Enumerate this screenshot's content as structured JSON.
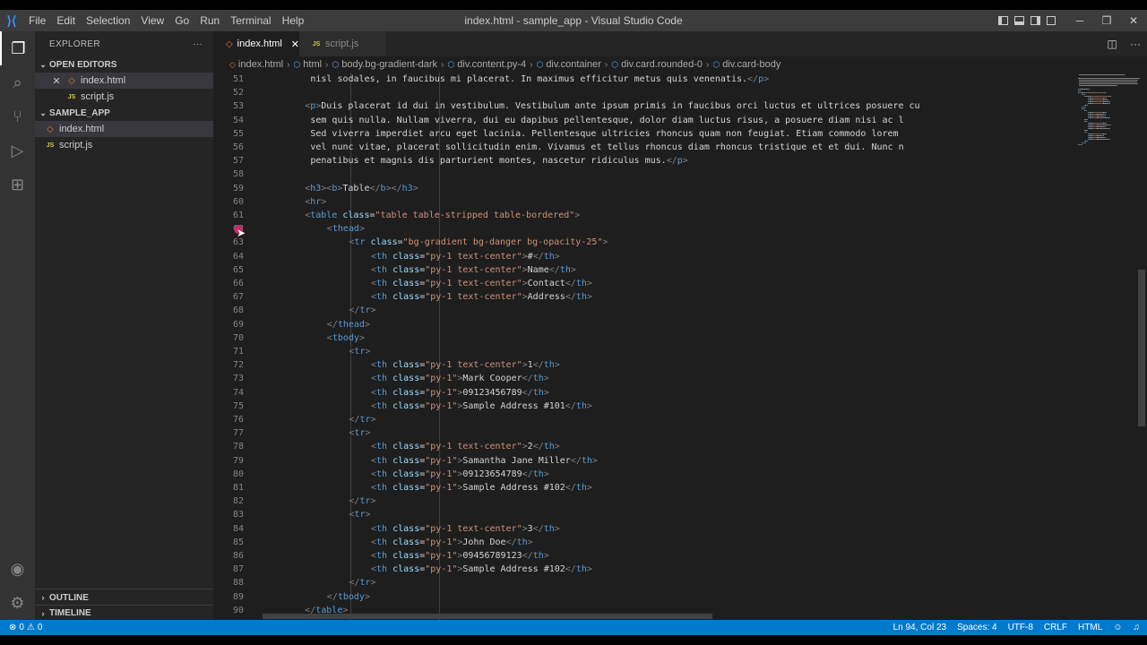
{
  "window": {
    "title": "index.html - sample_app - Visual Studio Code",
    "menu": [
      "File",
      "Edit",
      "Selection",
      "View",
      "Go",
      "Run",
      "Terminal",
      "Help"
    ],
    "minimize": "─",
    "restore": "❐",
    "close": "✕"
  },
  "activity_bar": {
    "items": [
      {
        "name": "explorer-icon",
        "glyph": "❐"
      },
      {
        "name": "search-icon",
        "glyph": "⌕"
      },
      {
        "name": "source-control-icon",
        "glyph": "⑂"
      },
      {
        "name": "run-debug-icon",
        "glyph": "▷"
      },
      {
        "name": "extensions-icon",
        "glyph": "⊞"
      }
    ],
    "accounts_glyph": "◉",
    "manage_glyph": "⚙"
  },
  "sidebar": {
    "title": "EXPLORER",
    "more": "···",
    "open_editors": {
      "label": "OPEN EDITORS",
      "files": [
        {
          "name": "index.html",
          "type": "html",
          "close": "✕"
        },
        {
          "name": "script.js",
          "type": "js"
        }
      ]
    },
    "folder": {
      "label": "SAMPLE_APP",
      "files": [
        {
          "name": "index.html",
          "type": "html"
        },
        {
          "name": "script.js",
          "type": "js"
        }
      ]
    },
    "outline": "OUTLINE",
    "timeline": "TIMELINE"
  },
  "tabs": [
    {
      "label": "index.html",
      "close": "✕",
      "active": true
    },
    {
      "label": "script.js",
      "active": false
    }
  ],
  "tab_actions": {
    "split": "◫",
    "more": "···"
  },
  "icons": {
    "html": "◇",
    "js": "JS",
    "element": "⬡",
    "chevron_right": "›",
    "chevron_down": "⌄"
  },
  "breadcrumbs": [
    {
      "label": "index.html",
      "kind": "file"
    },
    {
      "label": "html",
      "kind": "element"
    },
    {
      "label": "body.bg-gradient-dark",
      "kind": "element"
    },
    {
      "label": "div.content.py-4",
      "kind": "element"
    },
    {
      "label": "div.container",
      "kind": "element"
    },
    {
      "label": "div.card.rounded-0",
      "kind": "element"
    },
    {
      "label": "div.card-body",
      "kind": "element"
    }
  ],
  "code": [
    {
      "n": "51",
      "indent": 9,
      "t": [
        [
          "txt",
          "nisl sodales, in faucibus mi placerat. In maximus efficitur metus quis venenatis."
        ],
        [
          "br",
          "</"
        ],
        [
          "tag",
          "p"
        ],
        [
          "br",
          ">"
        ]
      ]
    },
    {
      "n": "52",
      "indent": 0,
      "t": []
    },
    {
      "n": "53",
      "indent": 8,
      "t": [
        [
          "br",
          "<"
        ],
        [
          "tag",
          "p"
        ],
        [
          "br",
          ">"
        ],
        [
          "txt",
          "Duis placerat id dui in vestibulum. Vestibulum ante ipsum primis in faucibus orci luctus et ultrices posuere cu"
        ]
      ]
    },
    {
      "n": "54",
      "indent": 9,
      "t": [
        [
          "txt",
          "sem quis nulla. Nullam viverra, dui eu dapibus pellentesque, dolor diam luctus risus, a posuere diam nisi ac l"
        ]
      ]
    },
    {
      "n": "55",
      "indent": 9,
      "t": [
        [
          "txt",
          "Sed viverra imperdiet arcu eget lacinia. Pellentesque ultricies rhoncus quam non feugiat. Etiam commodo lorem"
        ]
      ]
    },
    {
      "n": "56",
      "indent": 9,
      "t": [
        [
          "txt",
          "vel nunc vitae, placerat sollicitudin enim. Vivamus et tellus rhoncus diam rhoncus tristique et et dui. Nunc n"
        ]
      ]
    },
    {
      "n": "57",
      "indent": 9,
      "t": [
        [
          "txt",
          "penatibus et magnis dis parturient montes, nascetur ridiculus mus."
        ],
        [
          "br",
          "</"
        ],
        [
          "tag",
          "p"
        ],
        [
          "br",
          ">"
        ]
      ]
    },
    {
      "n": "58",
      "indent": 0,
      "t": []
    },
    {
      "n": "59",
      "indent": 8,
      "t": [
        [
          "br",
          "<"
        ],
        [
          "tag",
          "h3"
        ],
        [
          "br",
          ">"
        ],
        [
          "br",
          "<"
        ],
        [
          "tag",
          "b"
        ],
        [
          "br",
          ">"
        ],
        [
          "txt",
          "Table"
        ],
        [
          "br",
          "</"
        ],
        [
          "tag",
          "b"
        ],
        [
          "br",
          ">"
        ],
        [
          "br",
          "</"
        ],
        [
          "tag",
          "h3"
        ],
        [
          "br",
          ">"
        ]
      ]
    },
    {
      "n": "60",
      "indent": 8,
      "t": [
        [
          "br",
          "<"
        ],
        [
          "tag",
          "hr"
        ],
        [
          "br",
          ">"
        ]
      ]
    },
    {
      "n": "61",
      "indent": 8,
      "t": [
        [
          "br",
          "<"
        ],
        [
          "tag",
          "table"
        ],
        [
          "txt",
          " "
        ],
        [
          "attr",
          "class"
        ],
        [
          "txt",
          "="
        ],
        [
          "str",
          "\"table table-stripped table-bordered\""
        ],
        [
          "br",
          ">"
        ]
      ]
    },
    {
      "n": "62",
      "indent": 12,
      "t": [
        [
          "br",
          "<"
        ],
        [
          "tag",
          "thead"
        ],
        [
          "br",
          ">"
        ]
      ]
    },
    {
      "n": "63",
      "indent": 16,
      "t": [
        [
          "br",
          "<"
        ],
        [
          "tag",
          "tr"
        ],
        [
          "txt",
          " "
        ],
        [
          "attr",
          "class"
        ],
        [
          "txt",
          "="
        ],
        [
          "str",
          "\"bg-gradient bg-danger bg-opacity-25\""
        ],
        [
          "br",
          ">"
        ]
      ]
    },
    {
      "n": "64",
      "indent": 20,
      "t": [
        [
          "br",
          "<"
        ],
        [
          "tag",
          "th"
        ],
        [
          "txt",
          " "
        ],
        [
          "attr",
          "class"
        ],
        [
          "txt",
          "="
        ],
        [
          "str",
          "\"py-1 text-center\""
        ],
        [
          "br",
          ">"
        ],
        [
          "txt",
          "#"
        ],
        [
          "br",
          "</"
        ],
        [
          "tag",
          "th"
        ],
        [
          "br",
          ">"
        ]
      ]
    },
    {
      "n": "65",
      "indent": 20,
      "t": [
        [
          "br",
          "<"
        ],
        [
          "tag",
          "th"
        ],
        [
          "txt",
          " "
        ],
        [
          "attr",
          "class"
        ],
        [
          "txt",
          "="
        ],
        [
          "str",
          "\"py-1 text-center\""
        ],
        [
          "br",
          ">"
        ],
        [
          "txt",
          "Name"
        ],
        [
          "br",
          "</"
        ],
        [
          "tag",
          "th"
        ],
        [
          "br",
          ">"
        ]
      ]
    },
    {
      "n": "66",
      "indent": 20,
      "t": [
        [
          "br",
          "<"
        ],
        [
          "tag",
          "th"
        ],
        [
          "txt",
          " "
        ],
        [
          "attr",
          "class"
        ],
        [
          "txt",
          "="
        ],
        [
          "str",
          "\"py-1 text-center\""
        ],
        [
          "br",
          ">"
        ],
        [
          "txt",
          "Contact"
        ],
        [
          "br",
          "</"
        ],
        [
          "tag",
          "th"
        ],
        [
          "br",
          ">"
        ]
      ]
    },
    {
      "n": "67",
      "indent": 20,
      "t": [
        [
          "br",
          "<"
        ],
        [
          "tag",
          "th"
        ],
        [
          "txt",
          " "
        ],
        [
          "attr",
          "class"
        ],
        [
          "txt",
          "="
        ],
        [
          "str",
          "\"py-1 text-center\""
        ],
        [
          "br",
          ">"
        ],
        [
          "txt",
          "Address"
        ],
        [
          "br",
          "</"
        ],
        [
          "tag",
          "th"
        ],
        [
          "br",
          ">"
        ]
      ]
    },
    {
      "n": "68",
      "indent": 16,
      "t": [
        [
          "br",
          "</"
        ],
        [
          "tag",
          "tr"
        ],
        [
          "br",
          ">"
        ]
      ]
    },
    {
      "n": "69",
      "indent": 12,
      "t": [
        [
          "br",
          "</"
        ],
        [
          "tag",
          "thead"
        ],
        [
          "br",
          ">"
        ]
      ]
    },
    {
      "n": "70",
      "indent": 12,
      "t": [
        [
          "br",
          "<"
        ],
        [
          "tag",
          "tbody"
        ],
        [
          "br",
          ">"
        ]
      ]
    },
    {
      "n": "71",
      "indent": 16,
      "t": [
        [
          "br",
          "<"
        ],
        [
          "tag",
          "tr"
        ],
        [
          "br",
          ">"
        ]
      ]
    },
    {
      "n": "72",
      "indent": 20,
      "t": [
        [
          "br",
          "<"
        ],
        [
          "tag",
          "th"
        ],
        [
          "txt",
          " "
        ],
        [
          "attr",
          "class"
        ],
        [
          "txt",
          "="
        ],
        [
          "str",
          "\"py-1 text-center\""
        ],
        [
          "br",
          ">"
        ],
        [
          "txt",
          "1"
        ],
        [
          "br",
          "</"
        ],
        [
          "tag",
          "th"
        ],
        [
          "br",
          ">"
        ]
      ]
    },
    {
      "n": "73",
      "indent": 20,
      "t": [
        [
          "br",
          "<"
        ],
        [
          "tag",
          "th"
        ],
        [
          "txt",
          " "
        ],
        [
          "attr",
          "class"
        ],
        [
          "txt",
          "="
        ],
        [
          "str",
          "\"py-1\""
        ],
        [
          "br",
          ">"
        ],
        [
          "txt",
          "Mark Cooper"
        ],
        [
          "br",
          "</"
        ],
        [
          "tag",
          "th"
        ],
        [
          "br",
          ">"
        ]
      ]
    },
    {
      "n": "74",
      "indent": 20,
      "t": [
        [
          "br",
          "<"
        ],
        [
          "tag",
          "th"
        ],
        [
          "txt",
          " "
        ],
        [
          "attr",
          "class"
        ],
        [
          "txt",
          "="
        ],
        [
          "str",
          "\"py-1\""
        ],
        [
          "br",
          ">"
        ],
        [
          "txt",
          "09123456789"
        ],
        [
          "br",
          "</"
        ],
        [
          "tag",
          "th"
        ],
        [
          "br",
          ">"
        ]
      ]
    },
    {
      "n": "75",
      "indent": 20,
      "t": [
        [
          "br",
          "<"
        ],
        [
          "tag",
          "th"
        ],
        [
          "txt",
          " "
        ],
        [
          "attr",
          "class"
        ],
        [
          "txt",
          "="
        ],
        [
          "str",
          "\"py-1\""
        ],
        [
          "br",
          ">"
        ],
        [
          "txt",
          "Sample Address #101"
        ],
        [
          "br",
          "</"
        ],
        [
          "tag",
          "th"
        ],
        [
          "br",
          ">"
        ]
      ]
    },
    {
      "n": "76",
      "indent": 16,
      "t": [
        [
          "br",
          "</"
        ],
        [
          "tag",
          "tr"
        ],
        [
          "br",
          ">"
        ]
      ]
    },
    {
      "n": "77",
      "indent": 16,
      "t": [
        [
          "br",
          "<"
        ],
        [
          "tag",
          "tr"
        ],
        [
          "br",
          ">"
        ]
      ]
    },
    {
      "n": "78",
      "indent": 20,
      "t": [
        [
          "br",
          "<"
        ],
        [
          "tag",
          "th"
        ],
        [
          "txt",
          " "
        ],
        [
          "attr",
          "class"
        ],
        [
          "txt",
          "="
        ],
        [
          "str",
          "\"py-1 text-center\""
        ],
        [
          "br",
          ">"
        ],
        [
          "txt",
          "2"
        ],
        [
          "br",
          "</"
        ],
        [
          "tag",
          "th"
        ],
        [
          "br",
          ">"
        ]
      ]
    },
    {
      "n": "79",
      "indent": 20,
      "t": [
        [
          "br",
          "<"
        ],
        [
          "tag",
          "th"
        ],
        [
          "txt",
          " "
        ],
        [
          "attr",
          "class"
        ],
        [
          "txt",
          "="
        ],
        [
          "str",
          "\"py-1\""
        ],
        [
          "br",
          ">"
        ],
        [
          "txt",
          "Samantha Jane Miller"
        ],
        [
          "br",
          "</"
        ],
        [
          "tag",
          "th"
        ],
        [
          "br",
          ">"
        ]
      ]
    },
    {
      "n": "80",
      "indent": 20,
      "t": [
        [
          "br",
          "<"
        ],
        [
          "tag",
          "th"
        ],
        [
          "txt",
          " "
        ],
        [
          "attr",
          "class"
        ],
        [
          "txt",
          "="
        ],
        [
          "str",
          "\"py-1\""
        ],
        [
          "br",
          ">"
        ],
        [
          "txt",
          "09123654789"
        ],
        [
          "br",
          "</"
        ],
        [
          "tag",
          "th"
        ],
        [
          "br",
          ">"
        ]
      ]
    },
    {
      "n": "81",
      "indent": 20,
      "t": [
        [
          "br",
          "<"
        ],
        [
          "tag",
          "th"
        ],
        [
          "txt",
          " "
        ],
        [
          "attr",
          "class"
        ],
        [
          "txt",
          "="
        ],
        [
          "str",
          "\"py-1\""
        ],
        [
          "br",
          ">"
        ],
        [
          "txt",
          "Sample Address #102"
        ],
        [
          "br",
          "</"
        ],
        [
          "tag",
          "th"
        ],
        [
          "br",
          ">"
        ]
      ]
    },
    {
      "n": "82",
      "indent": 16,
      "t": [
        [
          "br",
          "</"
        ],
        [
          "tag",
          "tr"
        ],
        [
          "br",
          ">"
        ]
      ]
    },
    {
      "n": "83",
      "indent": 16,
      "t": [
        [
          "br",
          "<"
        ],
        [
          "tag",
          "tr"
        ],
        [
          "br",
          ">"
        ]
      ]
    },
    {
      "n": "84",
      "indent": 20,
      "t": [
        [
          "br",
          "<"
        ],
        [
          "tag",
          "th"
        ],
        [
          "txt",
          " "
        ],
        [
          "attr",
          "class"
        ],
        [
          "txt",
          "="
        ],
        [
          "str",
          "\"py-1 text-center\""
        ],
        [
          "br",
          ">"
        ],
        [
          "txt",
          "3"
        ],
        [
          "br",
          "</"
        ],
        [
          "tag",
          "th"
        ],
        [
          "br",
          ">"
        ]
      ]
    },
    {
      "n": "85",
      "indent": 20,
      "t": [
        [
          "br",
          "<"
        ],
        [
          "tag",
          "th"
        ],
        [
          "txt",
          " "
        ],
        [
          "attr",
          "class"
        ],
        [
          "txt",
          "="
        ],
        [
          "str",
          "\"py-1\""
        ],
        [
          "br",
          ">"
        ],
        [
          "txt",
          "John Doe"
        ],
        [
          "br",
          "</"
        ],
        [
          "tag",
          "th"
        ],
        [
          "br",
          ">"
        ]
      ]
    },
    {
      "n": "86",
      "indent": 20,
      "t": [
        [
          "br",
          "<"
        ],
        [
          "tag",
          "th"
        ],
        [
          "txt",
          " "
        ],
        [
          "attr",
          "class"
        ],
        [
          "txt",
          "="
        ],
        [
          "str",
          "\"py-1\""
        ],
        [
          "br",
          ">"
        ],
        [
          "txt",
          "09456789123"
        ],
        [
          "br",
          "</"
        ],
        [
          "tag",
          "th"
        ],
        [
          "br",
          ">"
        ]
      ]
    },
    {
      "n": "87",
      "indent": 20,
      "t": [
        [
          "br",
          "<"
        ],
        [
          "tag",
          "th"
        ],
        [
          "txt",
          " "
        ],
        [
          "attr",
          "class"
        ],
        [
          "txt",
          "="
        ],
        [
          "str",
          "\"py-1\""
        ],
        [
          "br",
          ">"
        ],
        [
          "txt",
          "Sample Address #102"
        ],
        [
          "br",
          "</"
        ],
        [
          "tag",
          "th"
        ],
        [
          "br",
          ">"
        ]
      ]
    },
    {
      "n": "88",
      "indent": 16,
      "t": [
        [
          "br",
          "</"
        ],
        [
          "tag",
          "tr"
        ],
        [
          "br",
          ">"
        ]
      ]
    },
    {
      "n": "89",
      "indent": 12,
      "t": [
        [
          "br",
          "</"
        ],
        [
          "tag",
          "tbody"
        ],
        [
          "br",
          ">"
        ]
      ]
    },
    {
      "n": "90",
      "indent": 8,
      "t": [
        [
          "br",
          "</"
        ],
        [
          "tag",
          "table"
        ],
        [
          "br",
          ">"
        ]
      ]
    }
  ],
  "status": {
    "errors": "0",
    "warnings": "0",
    "error_glyph": "⊗",
    "warning_glyph": "⚠",
    "position": "Ln 94, Col 23",
    "spaces": "Spaces: 4",
    "encoding": "UTF-8",
    "eol": "CRLF",
    "language": "HTML",
    "feedback_glyph": "☺",
    "bell_glyph": "♫"
  },
  "colors": {
    "tag": "#569cd6",
    "attribute": "#9cdcfe",
    "string": "#ce9178",
    "bracket": "#808080",
    "text": "#d4d4d4",
    "status_bar": "#007acc"
  }
}
